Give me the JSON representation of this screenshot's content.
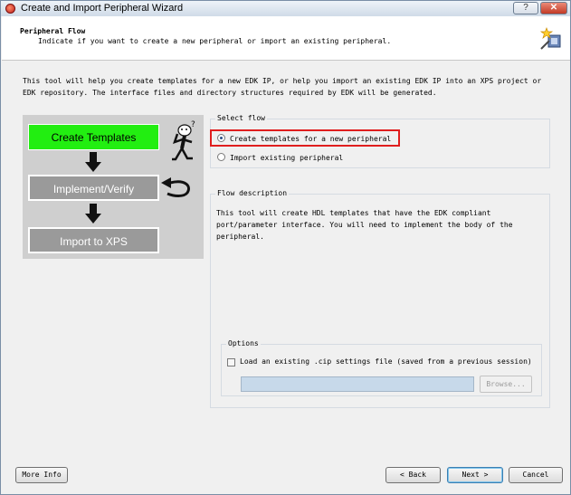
{
  "window": {
    "title": "Create and Import Peripheral Wizard",
    "help_label": "?",
    "close_label": "✕"
  },
  "header": {
    "title": "Peripheral Flow",
    "subtitle": "Indicate if you want to create a new peripheral or import an existing peripheral."
  },
  "intro": "This tool will help you create templates for a new EDK IP, or help you import an existing EDK IP into an XPS project or EDK repository. The interface files and directory structures required by EDK will be generated.",
  "flow_image": {
    "steps": [
      "Create Templates",
      "Implement/Verify",
      "Import to XPS"
    ],
    "active_color": "#22ee11",
    "inactive_color": "#9a9a9a"
  },
  "select_flow": {
    "label": "Select flow",
    "options": [
      {
        "label": "Create templates for a new peripheral",
        "selected": true
      },
      {
        "label": "Import existing peripheral",
        "selected": false
      }
    ]
  },
  "flow_description": {
    "label": "Flow description",
    "text": "This tool will create HDL templates that have the EDK compliant port/parameter interface. You will need to implement the body of the peripheral."
  },
  "options": {
    "label": "Options",
    "checkbox_label": "Load an existing .cip settings file (saved from a previous session)",
    "checked": false,
    "path_value": "",
    "browse_label": "Browse..."
  },
  "footer": {
    "more_info": "More Info",
    "back": "< Back",
    "next": "Next >",
    "cancel": "Cancel"
  }
}
